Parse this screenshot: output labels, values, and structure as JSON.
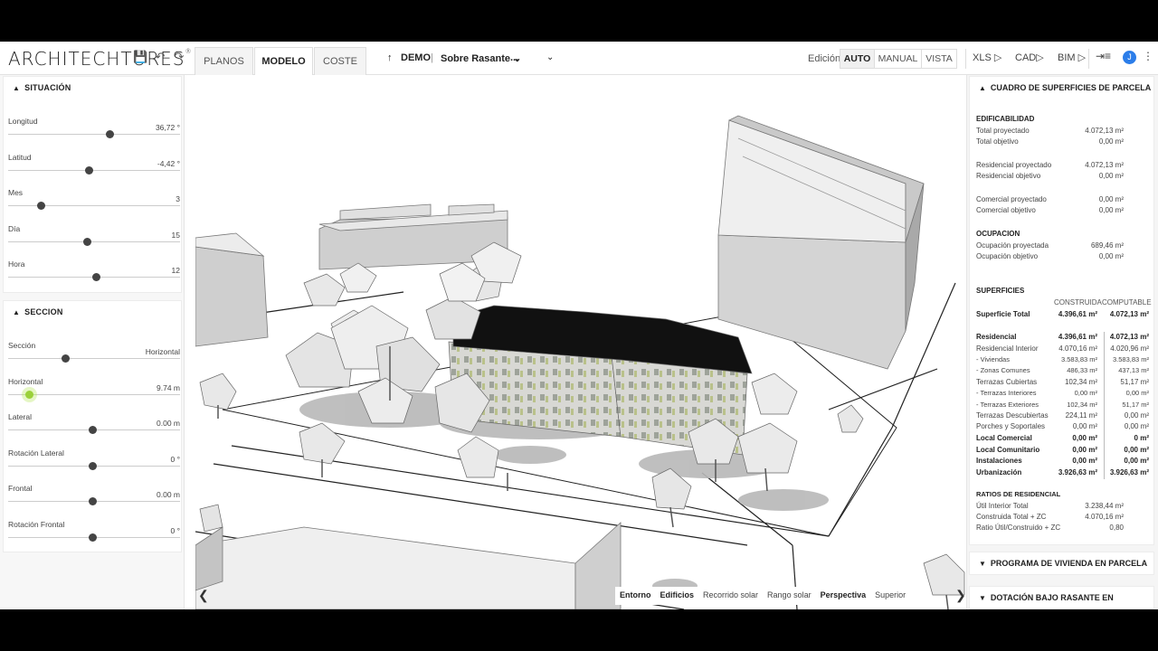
{
  "app": {
    "logo": "ARCHITECHTURES",
    "logo_mark": "®"
  },
  "tabs": [
    {
      "label": "PLANOS",
      "active": false
    },
    {
      "label": "MODELO",
      "active": true
    },
    {
      "label": "COSTE",
      "active": false
    }
  ],
  "project": {
    "name": "DEMO",
    "level": "Sobre Rasante",
    "more": "..."
  },
  "edition": {
    "label": "Edición:",
    "modes": [
      {
        "label": "AUTO",
        "active": true
      },
      {
        "label": "MANUAL",
        "active": false
      },
      {
        "label": "VISTA",
        "active": false
      }
    ]
  },
  "exports": [
    "XLS",
    "CAD",
    "BIM"
  ],
  "user": {
    "initial": "J"
  },
  "situacion": {
    "title": "SITUACIÓN",
    "sliders": [
      {
        "label": "Longitud",
        "value": "36,72 °",
        "pos": 0.59
      },
      {
        "label": "Latitud",
        "value": "-4,42 °",
        "pos": 0.47
      },
      {
        "label": "Mes",
        "value": "3",
        "pos": 0.19
      },
      {
        "label": "Día",
        "value": "15",
        "pos": 0.46
      },
      {
        "label": "Hora",
        "value": "12",
        "pos": 0.51
      }
    ]
  },
  "seccion": {
    "title": "SECCION",
    "sliders": [
      {
        "label": "Sección",
        "value": "Horizontal",
        "pos": 0.33
      },
      {
        "label": "Horizontal",
        "value": "9.74 m",
        "pos": 0.12
      },
      {
        "label": "Lateral",
        "value": "0.00 m",
        "pos": 0.49
      },
      {
        "label": "Rotación Lateral",
        "value": "0 °",
        "pos": 0.49
      },
      {
        "label": "Frontal",
        "value": "0.00 m",
        "pos": 0.49
      },
      {
        "label": "Rotación Frontal",
        "value": "0 °",
        "pos": 0.49
      }
    ]
  },
  "view_bar": [
    {
      "label": "Entorno",
      "bold": true
    },
    {
      "label": "Edificios",
      "bold": true
    },
    {
      "label": "Recorrido solar",
      "bold": false
    },
    {
      "label": "Rango solar",
      "bold": false
    },
    {
      "label": "Perspectiva",
      "bold": true
    },
    {
      "label": "Superior",
      "bold": false
    }
  ],
  "cuadro": {
    "title": "CUADRO DE SUPERFICIES DE PARCELA",
    "edificabilidad": {
      "title": "EDIFICABILIDAD",
      "rows": [
        {
          "label": "Total proyectado",
          "value": "4.072,13 m²"
        },
        {
          "label": "Total objetivo",
          "value": "0,00 m²"
        },
        {
          "label": "Residencial proyectado",
          "value": "4.072,13 m²"
        },
        {
          "label": "Residencial objetivo",
          "value": "0,00 m²"
        },
        {
          "label": "Comercial proyectado",
          "value": "0,00 m²"
        },
        {
          "label": "Comercial objetivo",
          "value": "0,00 m²"
        }
      ]
    },
    "ocupacion": {
      "title": "OCUPACION",
      "rows": [
        {
          "label": "Ocupación proyectada",
          "value": "689,46 m²"
        },
        {
          "label": "Ocupación objetivo",
          "value": "0,00 m²"
        }
      ]
    },
    "superficies": {
      "title": "SUPERFICIES",
      "col1": "CONSTRUIDA",
      "col2": "COMPUTABLE",
      "rows": [
        {
          "label": "Superficie Total",
          "c": "4.396,61 m²",
          "p": "4.072,13 m²",
          "bold": true
        },
        {
          "label": "Residencial",
          "c": "4.396,61 m²",
          "p": "4.072,13 m²",
          "bold": true
        },
        {
          "label": "Residencial Interior",
          "c": "4.070,16 m²",
          "p": "4.020,96 m²",
          "bold": false
        },
        {
          "label": "- Viviendas",
          "c": "3.583,83 m²",
          "p": "3.583,83 m²",
          "bold": false,
          "small": true
        },
        {
          "label": "- Zonas Comunes",
          "c": "486,33 m²",
          "p": "437,13 m²",
          "bold": false,
          "small": true
        },
        {
          "label": "Terrazas Cubiertas",
          "c": "102,34 m²",
          "p": "51,17 m²",
          "bold": false
        },
        {
          "label": "- Terrazas Interiores",
          "c": "0,00 m²",
          "p": "0,00 m²",
          "bold": false,
          "small": true
        },
        {
          "label": "- Terrazas Exteriores",
          "c": "102,34 m²",
          "p": "51,17 m²",
          "bold": false,
          "small": true
        },
        {
          "label": "Terrazas Descubiertas",
          "c": "224,11 m²",
          "p": "0,00 m²",
          "bold": false
        },
        {
          "label": "Porches y Soportales",
          "c": "0,00 m²",
          "p": "0,00 m²",
          "bold": false
        },
        {
          "label": "Local Comercial",
          "c": "0,00 m²",
          "p": "0 m²",
          "bold": true
        },
        {
          "label": "Local Comunitario",
          "c": "0,00 m²",
          "p": "0,00 m²",
          "bold": true
        },
        {
          "label": "Instalaciones",
          "c": "0,00 m²",
          "p": "0,00 m²",
          "bold": true
        },
        {
          "label": "Urbanización",
          "c": "3.926,63 m²",
          "p": "3.926,63 m²",
          "bold": true
        }
      ]
    },
    "ratios": {
      "title": "RATIOS DE RESIDENCIAL",
      "rows": [
        {
          "label": "Útil Interior Total",
          "value": "3.238,44 m²"
        },
        {
          "label": "Construida Total + ZC",
          "value": "4.070,16 m²"
        },
        {
          "label": "Ratio Útil/Construido + ZC",
          "value": "0,80"
        }
      ]
    }
  },
  "programa": {
    "title": "PROGRAMA DE VIVIENDA EN PARCELA"
  },
  "dotacion": {
    "title": "DOTACIÓN BAJO RASANTE EN PARCELA"
  }
}
